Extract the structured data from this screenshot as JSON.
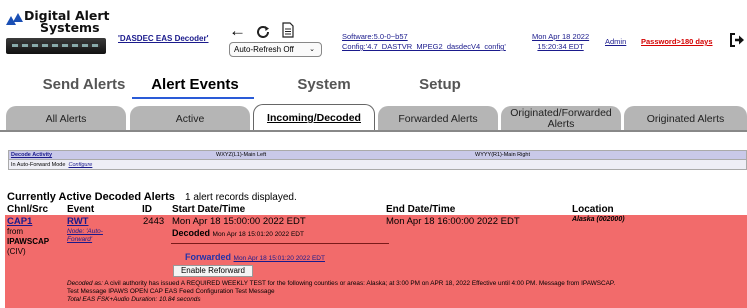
{
  "header": {
    "logo_line1": "Digital Alert",
    "logo_line2": "Systems",
    "decoder_name": "'DASDEC EAS Decoder'",
    "back_icon": "back-arrow-icon",
    "refresh_icon": "refresh-icon",
    "doc_icon": "document-icon",
    "refresh_select": "Auto-Refresh Off",
    "software_line1": "Software:5.0-0~b57",
    "software_line2": "Config:'4.7_DASTVR_MPEG2_dasdecV4_config'",
    "date_line1": "Mon Apr 18 2022",
    "date_line2": "15:20:34 EDT",
    "admin": "Admin",
    "password": "Password>180 days",
    "logout_icon": "logout-icon"
  },
  "mainnav": {
    "send": "Send Alerts",
    "events": "Alert Events",
    "system": "System",
    "setup": "Setup"
  },
  "tabs": {
    "all": "All Alerts",
    "active": "Active",
    "incoming": "Incoming/Decoded",
    "forwarded": "Forwarded Alerts",
    "originated_forwarded": "Originated/Forwarded Alerts",
    "originated": "Originated Alerts"
  },
  "monitor": {
    "decode_activity": "Decode Activity",
    "channel_left": "WXYZ(L1)-Main Left",
    "channel_right": "WYYY(R1)-Main Right",
    "mode_label": "In Auto-Forward Mode",
    "configure": "Configure"
  },
  "alerts": {
    "title": "Currently Active Decoded Alerts",
    "count_text": "1 alert records displayed.",
    "columns": {
      "chnl": "Chnl/Src",
      "event": "Event",
      "id": "ID",
      "start": "Start Date/Time",
      "end": "End Date/Time",
      "location": "Location"
    },
    "row": {
      "channel": "CAP1",
      "from": "from",
      "source": "IPAWSCAP",
      "civ": "(CIV)",
      "event": "RWT",
      "node": "Node: 'Auto-",
      "node2": "Forward'",
      "id": "2443",
      "start": "Mon Apr 18 15:00:00 2022 EDT",
      "decoded_label": "Decoded",
      "decoded_time": "Mon Apr 18 15:01:20 2022 EDT",
      "forwarded_label": "Forwarded",
      "forwarded_time": "Mon Apr 18 15:01:20 2022 EDT",
      "reforward_button": "Enable Reforward",
      "end": "Mon Apr 18 16:00:00 2022 EDT",
      "location": "Alaska (002000)",
      "decoded_as_label": "Decoded as:",
      "decoded_as": "A civil authority has issued A REQUIRED WEEKLY TEST for the following counties or areas: Alaska; at 3:00 PM on APR 18, 2022 Effective until 4:00 PM. Message from IPAWSCAP.",
      "test_message": "Test Message IPAWS OPEN CAP EAS Feed Configuration Test Message",
      "duration": "Total EAS FSK+Audio Duration: 10.84 seconds"
    }
  }
}
